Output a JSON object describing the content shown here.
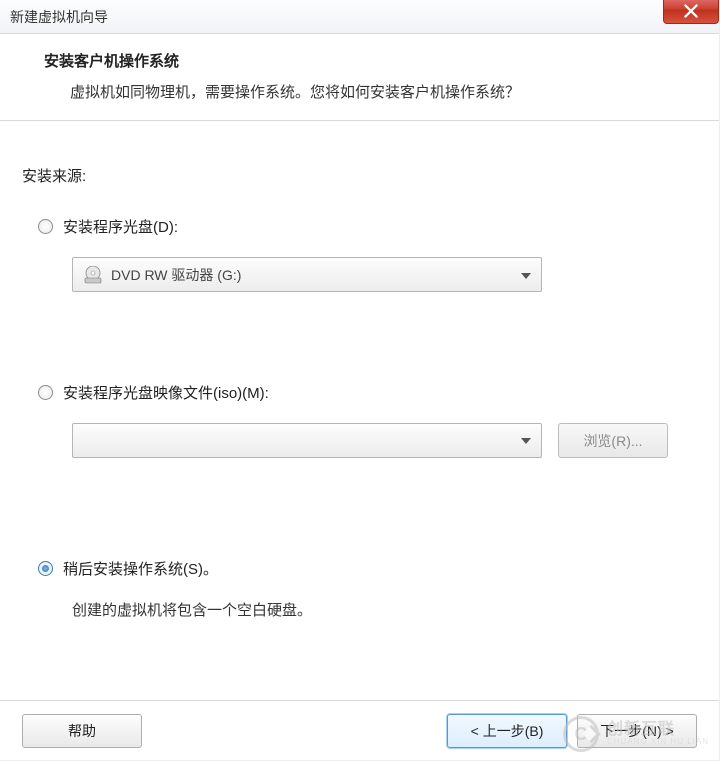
{
  "titlebar": {
    "title": "新建虚拟机向导"
  },
  "header": {
    "title": "安装客户机操作系统",
    "description": "虚拟机如同物理机，需要操作系统。您将如何安装客户机操作系统？"
  },
  "section_label": "安装来源:",
  "options": {
    "disc": {
      "label": "安装程序光盘(D):",
      "selected": false,
      "drive": "DVD RW 驱动器 (G:)"
    },
    "iso": {
      "label": "安装程序光盘映像文件(iso)(M):",
      "selected": false,
      "value": "",
      "browse_label": "浏览(R)..."
    },
    "later": {
      "label": "稍后安装操作系统(S)。",
      "selected": true,
      "note": "创建的虚拟机将包含一个空白硬盘。"
    }
  },
  "footer": {
    "help": "帮助",
    "back": "< 上一步(B)",
    "next": "下一步(N) >"
  },
  "watermark": {
    "main": "创新互联",
    "sub": "CHUANG XIN HU LIAN"
  }
}
